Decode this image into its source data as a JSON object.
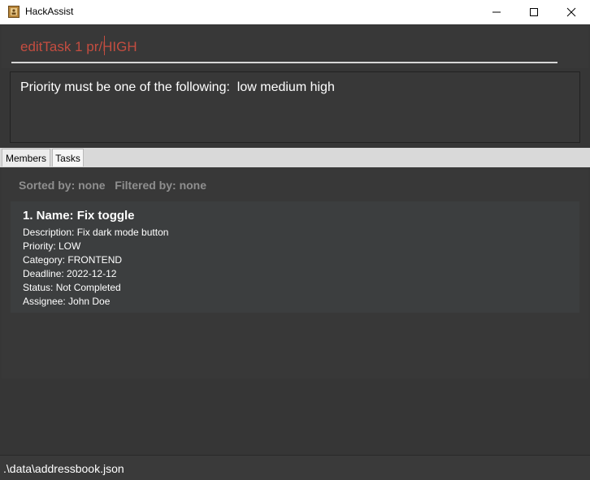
{
  "window": {
    "title": "HackAssist",
    "icon": "app-icon"
  },
  "command": {
    "value": "editTask 1 pr/HIGH"
  },
  "result": {
    "message": "Priority must be one of the following:  low medium high"
  },
  "tabs": [
    {
      "label": "Members"
    },
    {
      "label": "Tasks"
    }
  ],
  "list": {
    "sort_filter": "Sorted by: none   Filtered by: none",
    "tasks": [
      {
        "name": "1. Name: Fix toggle",
        "description": "Description: Fix dark mode button",
        "priority": "Priority: LOW",
        "category": "Category: FRONTEND",
        "deadline": "Deadline: 2022-12-12",
        "status": "Status: Not Completed",
        "assignee": "Assignee: John Doe"
      }
    ]
  },
  "status_bar": {
    "path": ".\\data\\addressbook.json"
  },
  "colors": {
    "background": "#363636",
    "error_text": "#c44d40",
    "card": "#3c3e3f"
  }
}
